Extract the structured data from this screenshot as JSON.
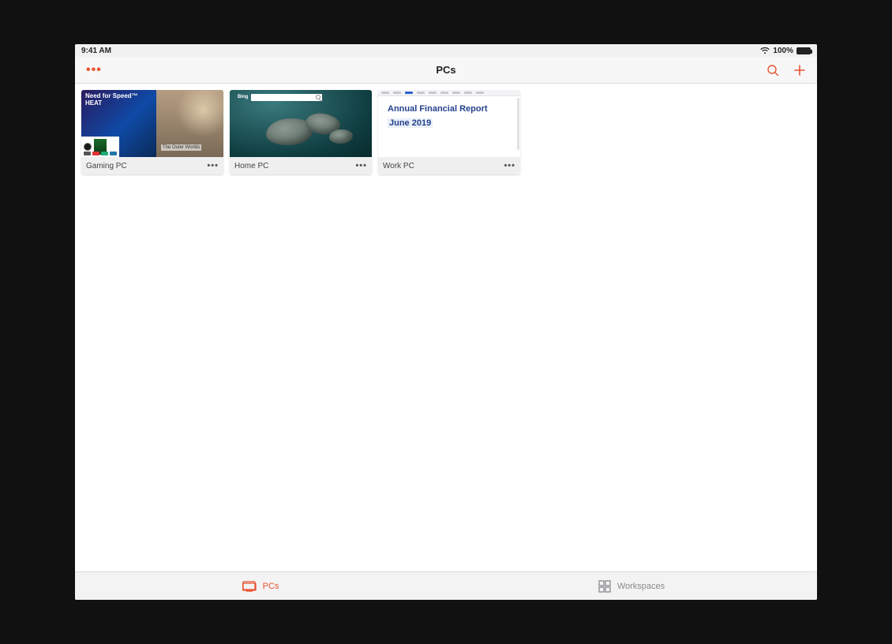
{
  "status": {
    "time": "9:41 AM",
    "battery_pct": "100%"
  },
  "nav": {
    "title": "PCs"
  },
  "cards": [
    {
      "label": "Gaming PC",
      "preview": {
        "window_left_title": "Need for Speed™ HEAT",
        "window_right_title": "The Outer Worlds"
      }
    },
    {
      "label": "Home PC",
      "preview": {
        "site": "Bing"
      }
    },
    {
      "label": "Work PC",
      "preview": {
        "doc_title": "Annual Financial Report",
        "doc_subtitle": "June 2019"
      }
    }
  ],
  "tabs": {
    "pcs": "PCs",
    "workspaces": "Workspaces"
  }
}
